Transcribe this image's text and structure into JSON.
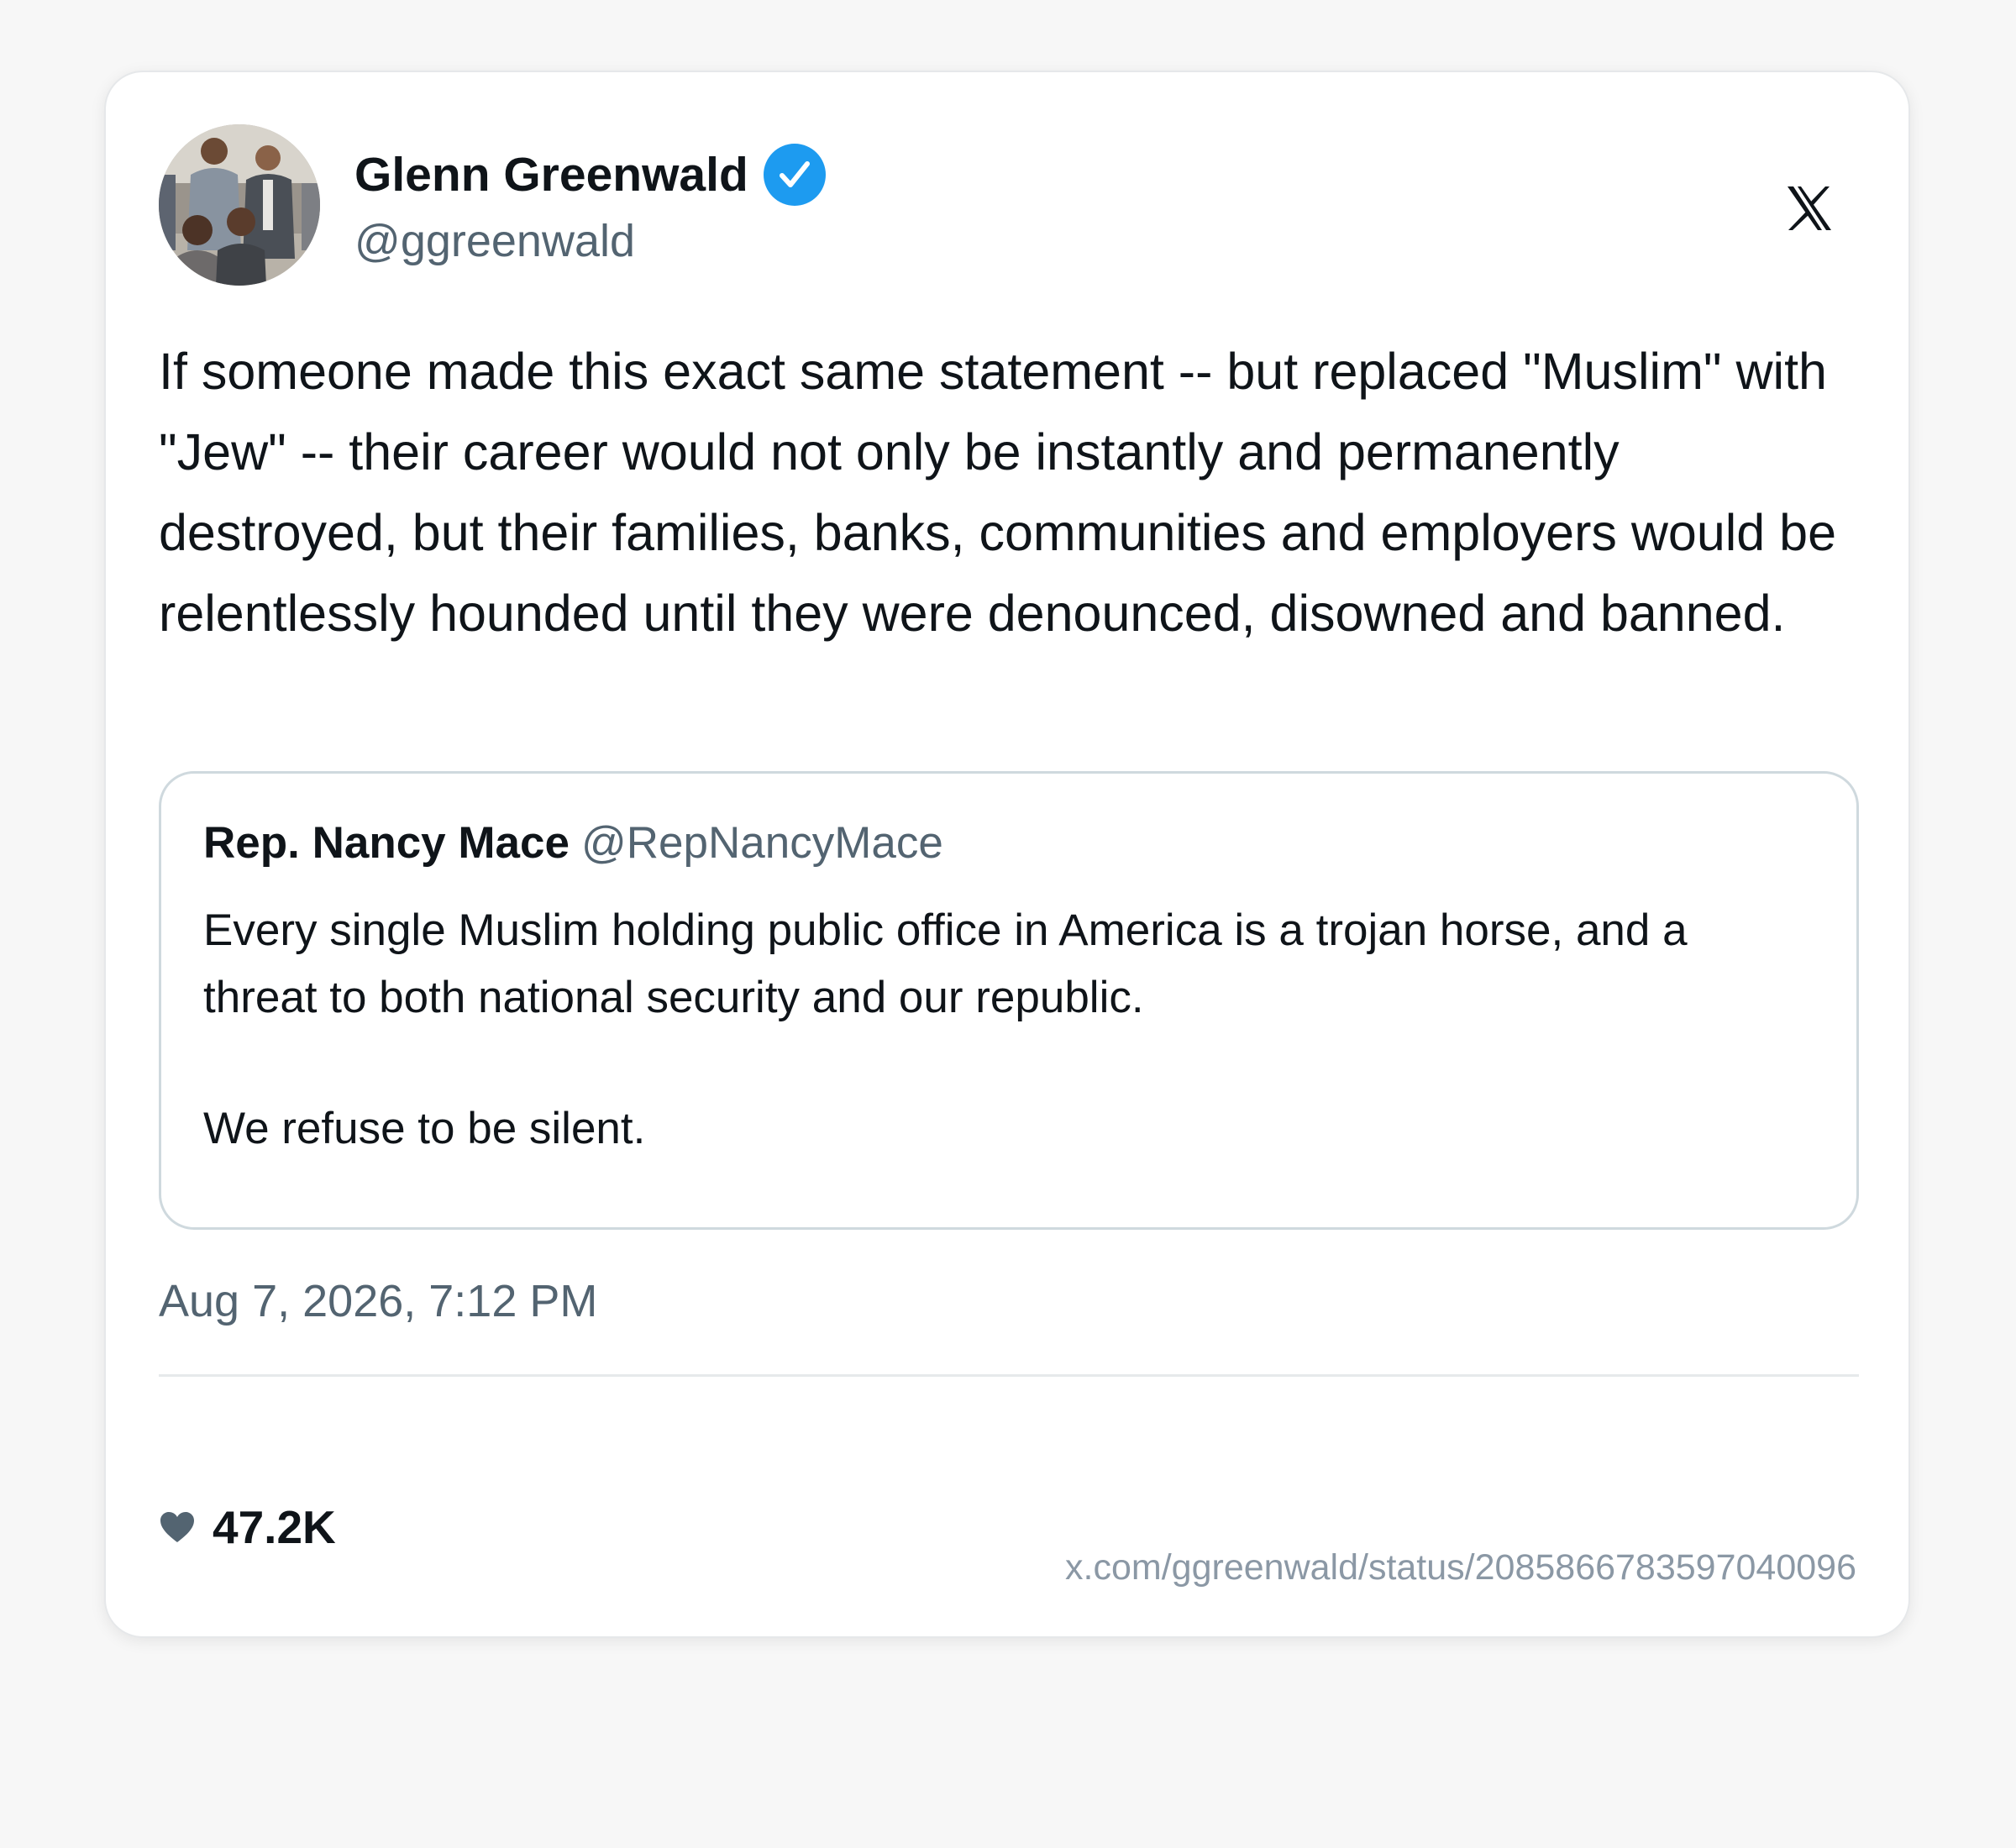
{
  "author": {
    "name": "Glenn Greenwald",
    "handle": "@ggreenwald",
    "verified": true
  },
  "icons": {
    "verified": "verified-badge-icon",
    "brand": "x-logo-icon",
    "like": "heart-icon"
  },
  "colors": {
    "verified_blue": "#1d9bf0",
    "secondary_text": "#536471"
  },
  "tweet": {
    "text": "If someone made this exact same statement -- but replaced \"Muslim\" with \"Jew\" -- their career would not only be instantly and permanently destroyed, but their families, banks, communities and employers would be relentlessly hounded until they were denounced, disowned and banned."
  },
  "quoted": {
    "name": "Rep. Nancy Mace",
    "handle": "@RepNancyMace",
    "lines": [
      "Every single Muslim holding public office in America is a trojan horse, and a",
      "threat to both national security and our republic.",
      "We refuse to be silent."
    ]
  },
  "timestamp": "Aug 7, 2026, 7:12 PM",
  "stats": {
    "likes": "47.2K"
  },
  "url": "x.com/ggreenwald/status/2085866783597040096"
}
